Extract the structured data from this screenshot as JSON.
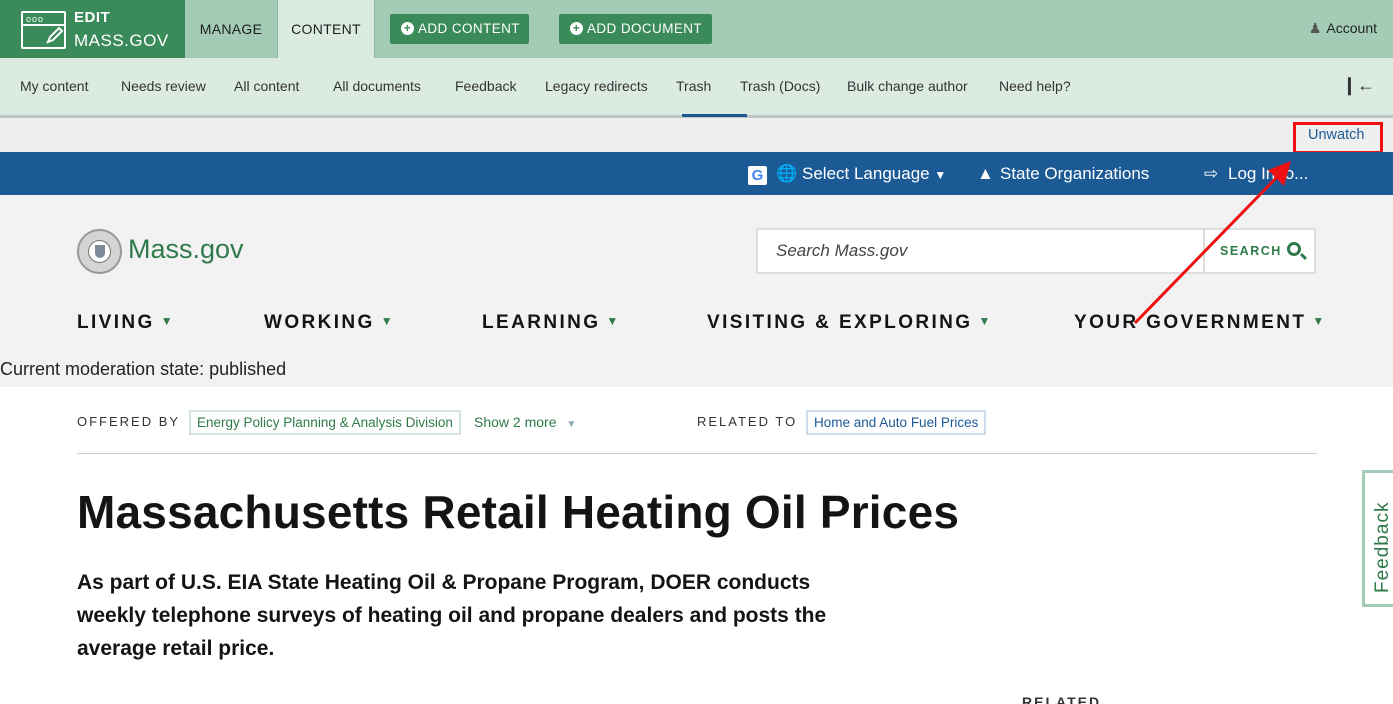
{
  "admin": {
    "brand_line1": "EDIT",
    "brand_line2": "MASS.GOV",
    "tabs": [
      "MANAGE",
      "CONTENT"
    ],
    "add_content": "ADD CONTENT",
    "add_document": "ADD DOCUMENT",
    "account": "Account",
    "subnav": [
      "My content",
      "Needs review",
      "All content",
      "All documents",
      "Feedback",
      "Legacy redirects",
      "Trash",
      "Trash (Docs)",
      "Bulk change author",
      "Need help?"
    ],
    "unwatch": "Unwatch"
  },
  "utility": {
    "language": "Select Language",
    "state_orgs": "State Organizations",
    "login": "Log In to..."
  },
  "header": {
    "site_name": "Mass.gov",
    "search_placeholder": "Search Mass.gov",
    "search_button": "SEARCH",
    "nav": [
      "LIVING",
      "WORKING",
      "LEARNING",
      "VISITING & EXPLORING",
      "YOUR GOVERNMENT"
    ]
  },
  "moderation_state": "Current moderation state: published",
  "page": {
    "offered_by_label": "OFFERED BY",
    "offered_by": "Energy Policy Planning & Analysis Division",
    "show_more": "Show 2 more",
    "related_to_label": "RELATED TO",
    "related_to": "Home and Auto Fuel Prices",
    "title": "Massachusetts Retail Heating Oil Prices",
    "lede": "As part of U.S. EIA State Heating Oil & Propane Program, DOER conducts weekly telephone surveys of heating oil and propane dealers and posts the average retail price.",
    "related_heading": "RELATED"
  },
  "feedback_tab": "Feedback",
  "colors": {
    "admin_green": "#3a8a5a",
    "admin_light": "#a3cbb5",
    "utility_blue": "#1c5a95",
    "annotation_red": "#ee1111"
  }
}
